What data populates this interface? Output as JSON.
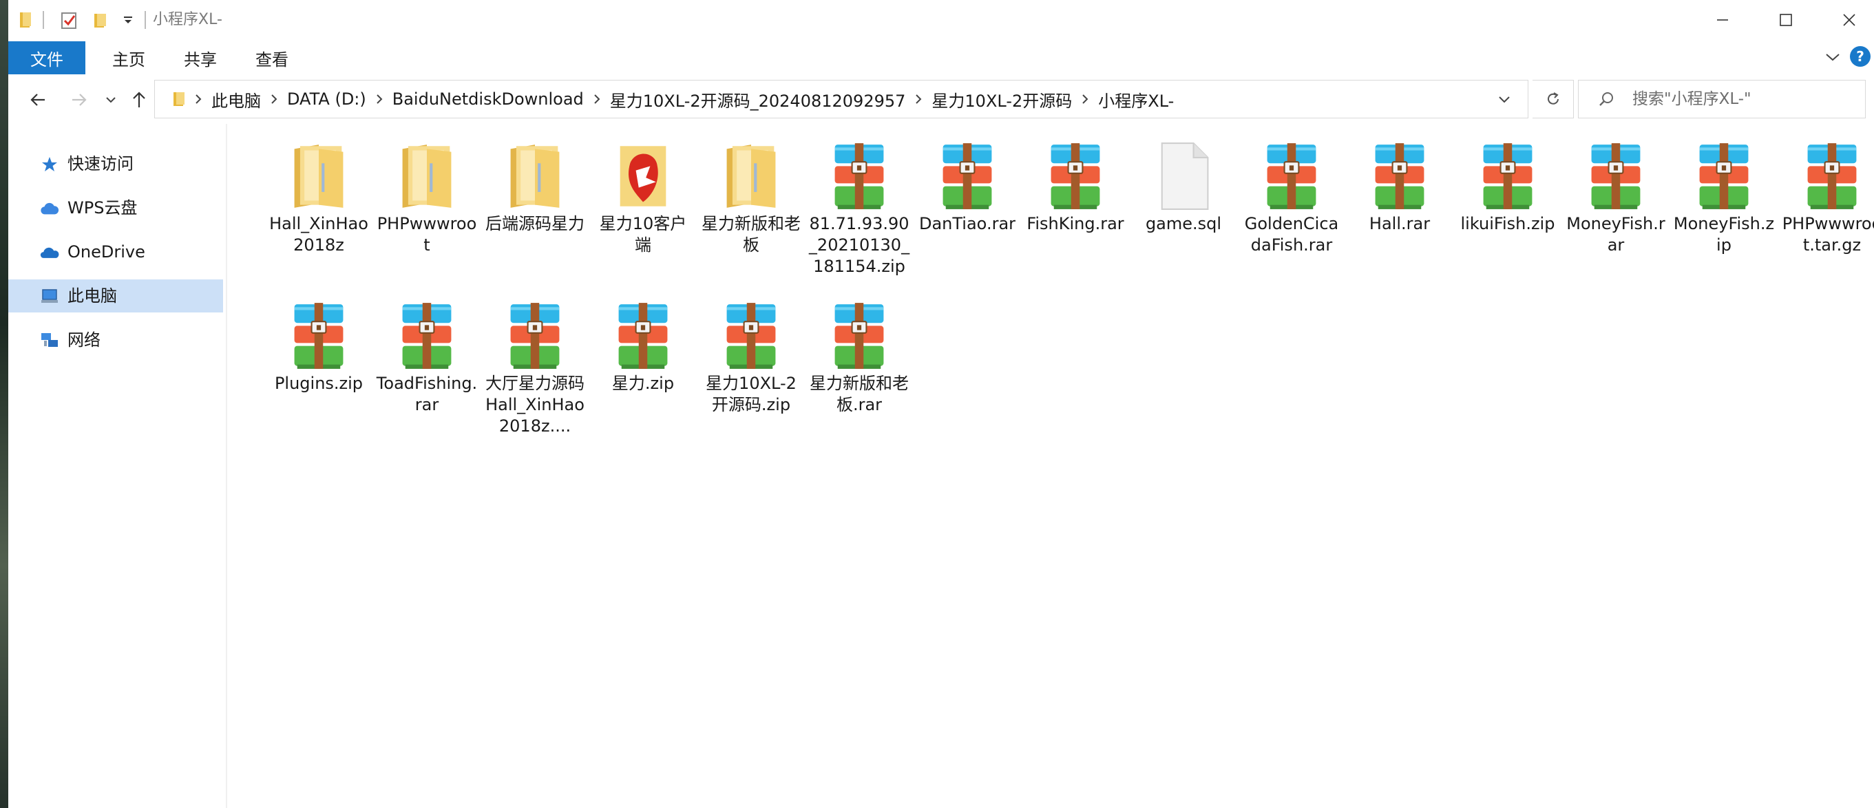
{
  "window": {
    "title": "小程序XL-",
    "quick_access_toolbar": [
      "folder-icon",
      "properties-check-icon",
      "new-folder-icon",
      "customize-dropdown-icon"
    ]
  },
  "ribbon": {
    "tabs": [
      {
        "label": "文件",
        "active": true
      },
      {
        "label": "主页",
        "active": false
      },
      {
        "label": "共享",
        "active": false
      },
      {
        "label": "查看",
        "active": false
      }
    ],
    "help_label": "?"
  },
  "address_bar": {
    "breadcrumbs": [
      "此电脑",
      "DATA (D:)",
      "BaiduNetdiskDownload",
      "星力10XL-2开源码_20240812092957",
      "星力10XL-2开源码",
      "小程序XL-"
    ]
  },
  "search": {
    "placeholder": "搜索\"小程序XL-\""
  },
  "sidebar": {
    "items": [
      {
        "label": "快速访问",
        "icon": "star-icon",
        "selected": false
      },
      {
        "label": "WPS云盘",
        "icon": "cloud-icon",
        "selected": false
      },
      {
        "label": "OneDrive",
        "icon": "onedrive-icon",
        "selected": false
      },
      {
        "label": "此电脑",
        "icon": "computer-icon",
        "selected": true
      },
      {
        "label": "网络",
        "icon": "network-icon",
        "selected": false
      }
    ]
  },
  "files": [
    {
      "name": "Hall_XinHao2018z",
      "type": "folder"
    },
    {
      "name": "PHPwwwroot",
      "type": "folder"
    },
    {
      "name": "后端源码星力",
      "type": "folder"
    },
    {
      "name": "星力10客户端",
      "type": "app-folder"
    },
    {
      "name": "星力新版和老板",
      "type": "folder"
    },
    {
      "name": "81.71.93.90_20210130_181154.zip",
      "type": "archive"
    },
    {
      "name": "DanTiao.rar",
      "type": "archive"
    },
    {
      "name": "FishKing.rar",
      "type": "archive"
    },
    {
      "name": "game.sql",
      "type": "file"
    },
    {
      "name": "GoldenCicadaFish.rar",
      "type": "archive"
    },
    {
      "name": "Hall.rar",
      "type": "archive"
    },
    {
      "name": "likuiFish.zip",
      "type": "archive"
    },
    {
      "name": "MoneyFish.rar",
      "type": "archive"
    },
    {
      "name": "MoneyFish.zip",
      "type": "archive"
    },
    {
      "name": "PHPwwwroot.tar.gz",
      "type": "archive"
    },
    {
      "name": "Plugins.zip",
      "type": "archive"
    },
    {
      "name": "ToadFishing.rar",
      "type": "archive"
    },
    {
      "name": "大厅星力源码Hall_XinHao2018z....",
      "type": "archive"
    },
    {
      "name": "星力.zip",
      "type": "archive"
    },
    {
      "name": "星力10XL-2开源码.zip",
      "type": "archive"
    },
    {
      "name": "星力新版和老板.rar",
      "type": "archive"
    }
  ],
  "colors": {
    "accent": "#1979ca",
    "selection": "#cce0f7",
    "folder": "#f2d37a",
    "archive_top": "#2fb6e8",
    "archive_mid": "#ef5f3c",
    "archive_bottom": "#54b948",
    "archive_strap": "#a35a2a"
  }
}
